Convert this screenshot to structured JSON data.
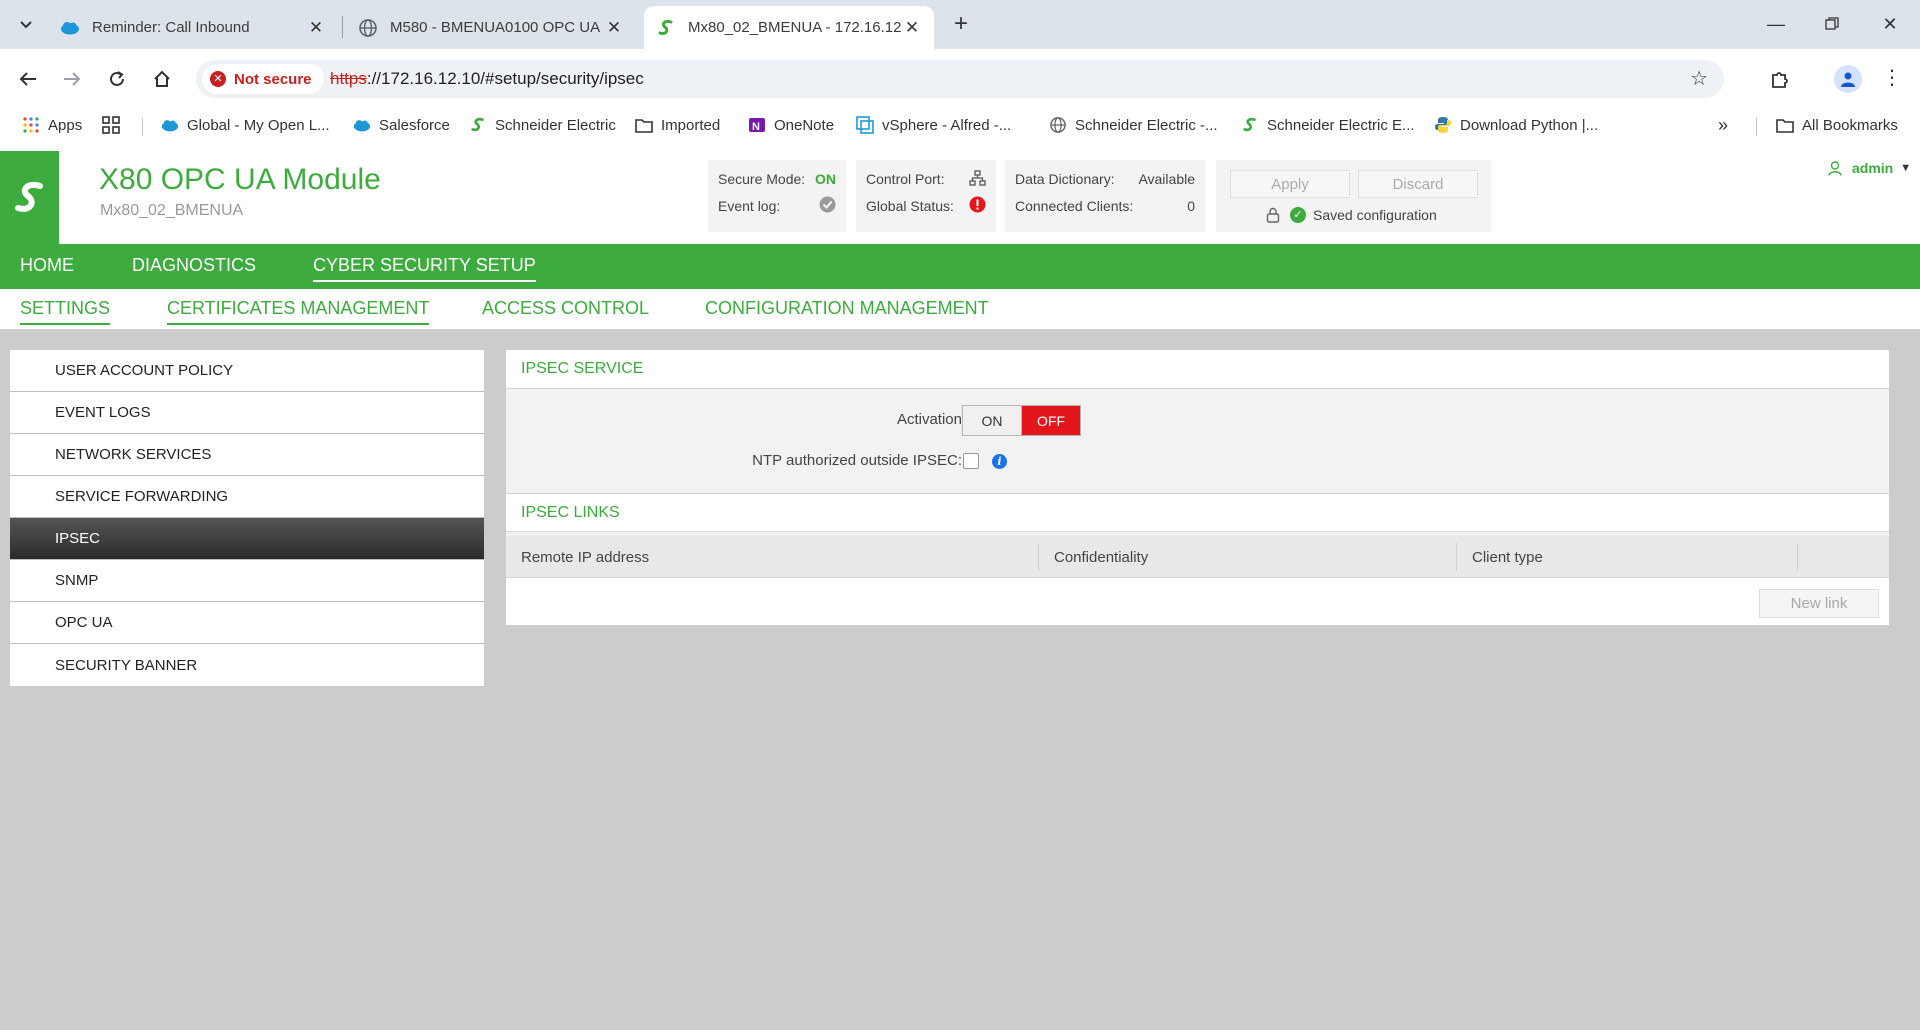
{
  "browser": {
    "tabs": [
      {
        "title": "Reminder: Call Inbound",
        "icon": "salesforce-cloud-icon"
      },
      {
        "title": "M580 - BMENUA0100 OPC UA",
        "icon": "globe-icon"
      },
      {
        "title": "Mx80_02_BMENUA - 172.16.12.",
        "icon": "schneider-icon"
      }
    ],
    "security_label": "Not secure",
    "url_scheme": "https",
    "url_rest": "://172.16.12.10/#setup/security/ipsec",
    "bookmarks": [
      {
        "label": "Apps",
        "icon": "apps-grid-icon"
      },
      {
        "label": "Global - My Open L...",
        "icon": "salesforce-cloud-icon"
      },
      {
        "label": "Salesforce",
        "icon": "salesforce-cloud-icon"
      },
      {
        "label": "Schneider Electric",
        "icon": "schneider-icon"
      },
      {
        "label": "Imported",
        "icon": "folder-icon"
      },
      {
        "label": "OneNote",
        "icon": "onenote-icon"
      },
      {
        "label": "vSphere - Alfred -...",
        "icon": "vsphere-icon"
      },
      {
        "label": "Schneider Electric -...",
        "icon": "globe-icon"
      },
      {
        "label": "Schneider Electric E...",
        "icon": "schneider-icon"
      },
      {
        "label": "Download Python |...",
        "icon": "python-icon"
      }
    ],
    "all_bookmarks": "All Bookmarks"
  },
  "app": {
    "title": "X80 OPC UA Module",
    "subtitle": "Mx80_02_BMENUA",
    "status": {
      "secure_mode_label": "Secure Mode:",
      "secure_mode_value": "ON",
      "event_log_label": "Event log:",
      "control_port_label": "Control Port:",
      "global_status_label": "Global Status:",
      "data_dictionary_label": "Data Dictionary:",
      "data_dictionary_value": "Available",
      "connected_clients_label": "Connected Clients:",
      "connected_clients_value": "0"
    },
    "apply_label": "Apply",
    "discard_label": "Discard",
    "saved_label": "Saved configuration",
    "user": "admin",
    "accent_color": "#3dab3d",
    "off_color": "#e3171b"
  },
  "nav": {
    "main": [
      "HOME",
      "DIAGNOSTICS",
      "CYBER SECURITY SETUP"
    ],
    "sub": [
      "SETTINGS",
      "CERTIFICATES MANAGEMENT",
      "ACCESS CONTROL",
      "CONFIGURATION MANAGEMENT"
    ]
  },
  "side_menu": [
    "USER ACCOUNT POLICY",
    "EVENT LOGS",
    "NETWORK SERVICES",
    "SERVICE FORWARDING",
    "IPSEC",
    "SNMP",
    "OPC UA",
    "SECURITY BANNER"
  ],
  "ipsec": {
    "service_title": "IPSEC SERVICE",
    "activation_label": "Activation",
    "toggle_on": "ON",
    "toggle_off": "OFF",
    "ntp_label": "NTP authorized outside IPSEC:",
    "links_title": "IPSEC LINKS",
    "columns": [
      "Remote IP address",
      "Confidentiality",
      "Client type"
    ],
    "new_link_label": "New link"
  }
}
